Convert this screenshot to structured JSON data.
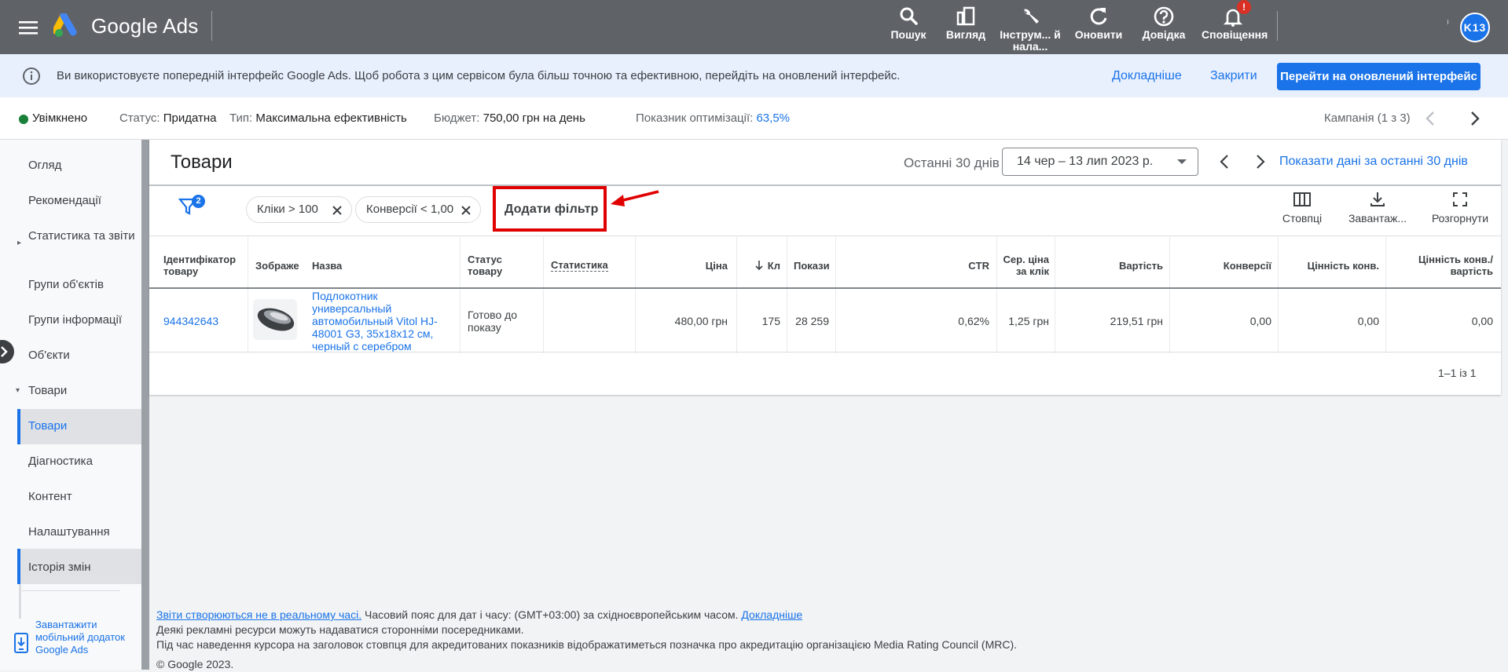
{
  "app": {
    "brand": "Google Ads"
  },
  "header": {
    "items": [
      {
        "label": "Пошук",
        "icon": "search-icon"
      },
      {
        "label": "Вигляд",
        "icon": "appearance-icon"
      },
      {
        "label": "Інструм... й нала...",
        "icon": "wrench-icon"
      },
      {
        "label": "Оновити",
        "icon": "refresh-icon"
      },
      {
        "label": "Довідка",
        "icon": "help-icon"
      },
      {
        "label": "Сповіщення",
        "icon": "bell-icon"
      }
    ],
    "notification_badge": "!",
    "avatar": "K13"
  },
  "banner": {
    "message": "Ви використовуєте попередній інтерфейс Google Ads. Щоб робота з цим сервісом була більш точною та ефективною, перейдіть на оновлений інтерфейс.",
    "learn_more": "Докладніше",
    "close": "Закрити",
    "cta": "Перейти на оновлений інтерфейс"
  },
  "status": {
    "enabled": "Увімкнено",
    "status_label": "Статус:",
    "status_value": "Придатна",
    "type_label": "Тип:",
    "type_value": "Максимальна ефективність",
    "budget_label": "Бюджет:",
    "budget_value": "750,00 грн на день",
    "score_label": "Показник оптимізації:",
    "score_value": "63,5%",
    "campaign_counter": "Кампанія (1 з 3)",
    "status_color": "#188038"
  },
  "sidebar": {
    "items": [
      {
        "label": "Огляд"
      },
      {
        "label": "Рекомендації"
      },
      {
        "label": "Статистика та звіти"
      },
      {
        "label": "Групи об'єктів"
      },
      {
        "label": "Групи інформації"
      },
      {
        "label": "Об'єкти"
      },
      {
        "label": "Товари"
      },
      {
        "label": "Товари"
      },
      {
        "label": "Діагностика"
      },
      {
        "label": "Контент"
      },
      {
        "label": "Налаштування"
      },
      {
        "label": "Історія змін"
      }
    ],
    "app_promo": "Завантажити мобільний додаток Google Ads"
  },
  "page": {
    "title": "Товари",
    "date_label": "Останні 30 днів",
    "date_range": "14 чер – 13 лип 2023 р.",
    "show_last_30": "Показати дані за останні 30 днів"
  },
  "filters": {
    "count": "2",
    "chips": [
      "Кліки > 100",
      "Конверсії < 1,00"
    ],
    "add_filter": "Додати фільтр"
  },
  "tools": [
    "Стовпці",
    "Завантаж...",
    "Розгорнути"
  ],
  "table": {
    "headers": [
      "Ідентифікатор товару",
      "Зображе",
      "Назва",
      "Статус товару",
      "Статистика",
      "Ціна",
      "Кл",
      "Покази",
      "CTR",
      "Сер. ціна за клік",
      "Вартість",
      "Конверсії",
      "Цінність конв.",
      "Цінність конв./ вартість"
    ],
    "rows": [
      {
        "id": "944342643",
        "name": "Подлокотник универсальный автомобильный Vitol HJ-48001 G3, 35x18x12 см, черный с серебром",
        "status": "Готово до показу",
        "stats": "",
        "price": "480,00 грн",
        "clicks": "175",
        "impressions": "28 259",
        "ctr": "0,62%",
        "avg_cpc": "1,25 грн",
        "cost": "219,51 грн",
        "conversions": "0,00",
        "conv_value": "0,00",
        "conv_value_cost": "0,00"
      }
    ],
    "pager": "1–1 із 1"
  },
  "footer": {
    "link1": "Звіти створюються не в реальному часі.",
    "text1": "Часовий пояс для дат і часу: (GMT+03:00) за східноєвропейським часом.",
    "link2": "Докладніше",
    "line2": "Деякі рекламні ресурси можуть надаватися сторонніми посередниками.",
    "line3": "Під час наведення курсора на заголовок стовпця для акредитованих показників відображатиметься позначка про акредитацію організацією Media Rating Council (MRC).",
    "copyright": "© Google 2023."
  },
  "colors": {
    "accent": "#1a73e8",
    "topbar": "#5f6368",
    "highlight": "#e00000"
  }
}
